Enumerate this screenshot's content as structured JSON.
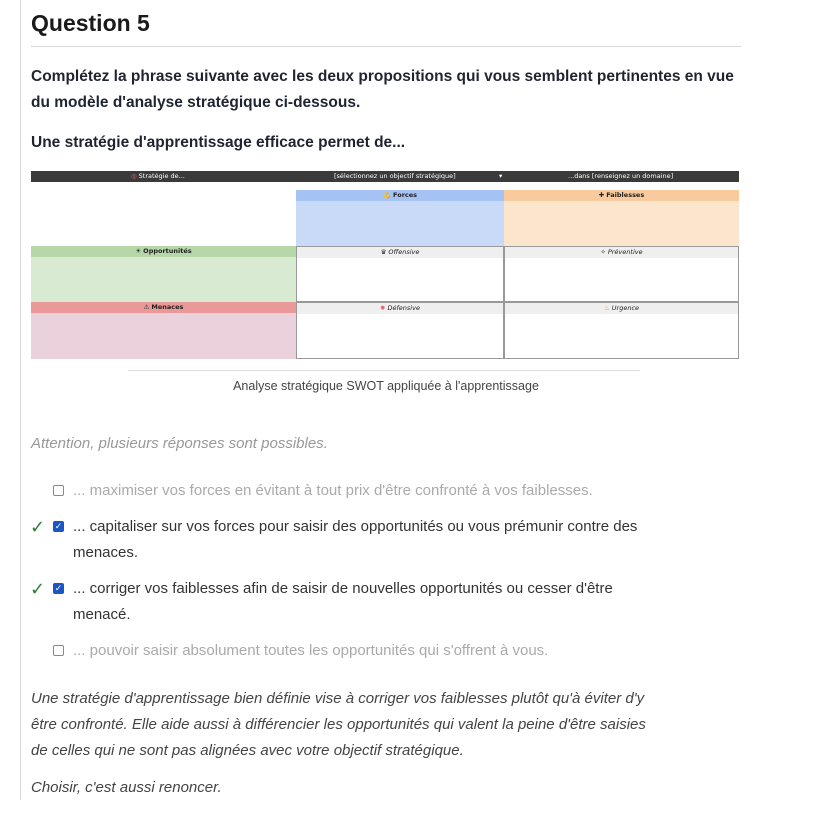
{
  "question": {
    "title": "Question 5",
    "intro": "Complétez la phrase suivante avec les deux propositions qui vous semblent pertinentes en vue du modèle d'analyse stratégique ci-dessous.",
    "subquestion": "Une stratégie d'apprentissage efficace permet de..."
  },
  "swot": {
    "bar": {
      "left": "Stratégie de...",
      "middle": "[sélectionnez un objectif stratégique]",
      "right": "...dans [renseignez un domaine]"
    },
    "forces": "Forces",
    "faiblesses": "Faiblesses",
    "opportunites": "Opportunités",
    "menaces": "Menaces",
    "offensive": "Offensive",
    "preventive": "Préventive",
    "defensive": "Défensive",
    "urgence": "Urgence",
    "colors": {
      "forces": "#c9daf8",
      "forces_header": "#a4c2f4",
      "faiblesses": "#fce5cd",
      "faiblesses_header": "#f9cb9c",
      "opportunites": "#d9ead3",
      "opportunites_header": "#b6d7a8",
      "menaces": "#ead1dc",
      "menaces_header": "#ea9999"
    }
  },
  "caption": "Analyse stratégique SWOT appliquée à l'apprentissage",
  "attention": "Attention, plusieurs réponses sont possibles.",
  "options": [
    {
      "text": "... maximiser vos forces en évitant à tout prix d'être confronté à vos faiblesses.",
      "checked": false,
      "correct": false
    },
    {
      "line1": "... capitaliser sur vos forces pour saisir des opportunités ou vous prémunir contre des",
      "line2": "menaces.",
      "checked": true,
      "correct": true
    },
    {
      "line1": "... corriger vos faiblesses afin de saisir de nouvelles opportunités ou cesser d'être",
      "line2": "menacé.",
      "checked": true,
      "correct": true
    },
    {
      "text": "... pouvoir saisir absolument toutes les opportunités qui s'offrent à vous.",
      "checked": false,
      "correct": false
    }
  ],
  "feedback": {
    "line1": " Une stratégie d'apprentissage bien définie vise à corriger vos faiblesses plutôt qu'à éviter d'y",
    "line2": "être confronté. Elle aide aussi à différencier les opportunités qui valent la peine d'être saisies",
    "line3": "de celles qui ne sont pas alignées avec votre objectif stratégique.",
    "closing": "Choisir, c'est aussi renoncer."
  }
}
